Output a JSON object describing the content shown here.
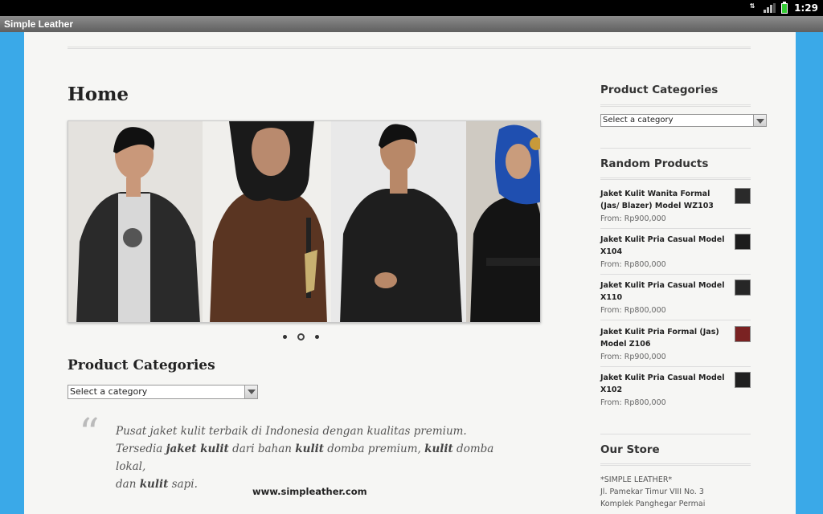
{
  "status_bar": {
    "time": "1:29",
    "data_indicator": "3G"
  },
  "app": {
    "title": "Simple Leather"
  },
  "main": {
    "page_title": "Home",
    "slider": {
      "slide_count": 3,
      "active_slide": 2
    },
    "product_categories": {
      "heading": "Product Categories",
      "select_value": "Select a category"
    },
    "quote": {
      "line1": "Pusat jaket kulit terbaik di Indonesia dengan kualitas premium.",
      "line2_pre": "Tersedia ",
      "line2_b1": "jaket kulit",
      "line2_mid1": " dari bahan ",
      "line2_b2": "kulit",
      "line2_mid2": " domba premium, ",
      "line2_b3": "kulit",
      "line2_mid3": " domba lokal,",
      "line3_pre": "dan ",
      "line3_b": "kulit",
      "line3_post": " sapi."
    },
    "site_url": "www.simpleather.com"
  },
  "sidebar": {
    "categories": {
      "heading": "Product Categories",
      "select_value": "Select a category"
    },
    "random_products": {
      "heading": "Random Products",
      "items": [
        {
          "name": "Jaket Kulit Wanita Formal (Jas/ Blazer) Model WZ103",
          "price": "From: Rp900,000",
          "thumb_color": "#2a2a2a"
        },
        {
          "name": "Jaket Kulit Pria Casual Model X104",
          "price": "From: Rp800,000",
          "thumb_color": "#1c1c1c"
        },
        {
          "name": "Jaket Kulit Pria Casual Model X110",
          "price": "From: Rp800,000",
          "thumb_color": "#262626"
        },
        {
          "name": "Jaket Kulit Pria Formal (Jas) Model Z106",
          "price": "From: Rp900,000",
          "thumb_color": "#7a2222"
        },
        {
          "name": "Jaket Kulit Pria Casual Model X102",
          "price": "From: Rp800,000",
          "thumb_color": "#202020"
        }
      ]
    },
    "store": {
      "heading": "Our Store",
      "lines": [
        "*SIMPLE LEATHER*",
        "Jl. Pamekar Timur VIII No. 3",
        "Komplek Panghegar Permai"
      ]
    }
  },
  "colors": {
    "frame_blue": "#3aa9e8",
    "page_bg": "#f6f6f4"
  }
}
